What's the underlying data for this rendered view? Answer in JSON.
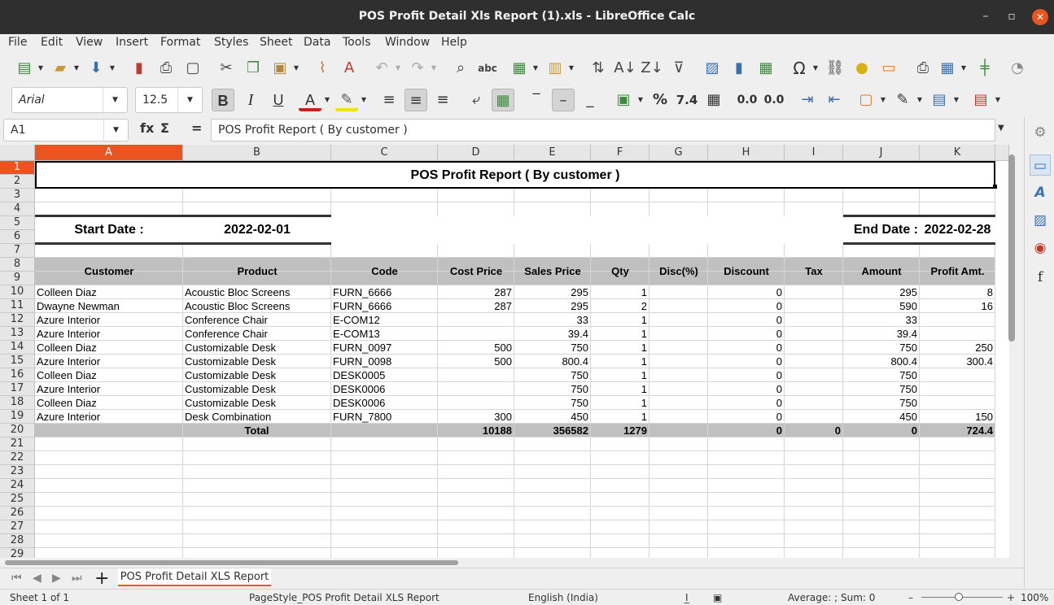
{
  "window": {
    "title": "POS Profit Detail Xls Report (1).xls - LibreOffice Calc",
    "close_glyph": "✕",
    "max_glyph": "▫",
    "min_glyph": "–"
  },
  "menu": [
    "File",
    "Edit",
    "View",
    "Insert",
    "Format",
    "Styles",
    "Sheet",
    "Data",
    "Tools",
    "Window",
    "Help"
  ],
  "font": {
    "name": "Arial",
    "size": "12.5"
  },
  "formula_bar": {
    "cell_ref": "A1",
    "content": "POS Profit Report ( By customer )",
    "fx": "fx",
    "sigma": "Σ",
    "eq": "="
  },
  "columns": [
    "A",
    "B",
    "C",
    "D",
    "E",
    "F",
    "G",
    "H",
    "I",
    "J",
    "K"
  ],
  "rows": [
    "1",
    "2",
    "3",
    "4",
    "5",
    "6",
    "7",
    "8",
    "9",
    "10",
    "11",
    "12",
    "13",
    "14",
    "15",
    "16",
    "17",
    "18",
    "19",
    "20",
    "21",
    "22",
    "23",
    "24",
    "25",
    "26",
    "27",
    "28",
    "29"
  ],
  "report": {
    "title": "POS Profit Report ( By customer )",
    "start_label": "Start Date :",
    "start_value": "2022-02-01",
    "end_label": "End Date :",
    "end_value": "2022-02-28",
    "headers": [
      "Customer",
      "Product",
      "Code",
      "Cost Price",
      "Sales Price",
      "Qty",
      "Disc(%)",
      "Discount",
      "Tax",
      "Amount",
      "Profit Amt."
    ],
    "data": [
      [
        "Colleen Diaz",
        "Acoustic Bloc Screens",
        "FURN_6666",
        "287",
        "295",
        "1",
        "",
        "0",
        "",
        "295",
        "8"
      ],
      [
        "Dwayne Newman",
        "Acoustic Bloc Screens",
        "FURN_6666",
        "287",
        "295",
        "2",
        "",
        "0",
        "",
        "590",
        "16"
      ],
      [
        "Azure Interior",
        "Conference Chair",
        "E-COM12",
        "",
        "33",
        "1",
        "",
        "0",
        "",
        "33",
        ""
      ],
      [
        "Azure Interior",
        "Conference Chair",
        "E-COM13",
        "",
        "39.4",
        "1",
        "",
        "0",
        "",
        "39.4",
        ""
      ],
      [
        "Colleen Diaz",
        "Customizable Desk",
        "FURN_0097",
        "500",
        "750",
        "1",
        "",
        "0",
        "",
        "750",
        "250"
      ],
      [
        "Azure Interior",
        "Customizable Desk",
        "FURN_0098",
        "500",
        "800.4",
        "1",
        "",
        "0",
        "",
        "800.4",
        "300.4"
      ],
      [
        "Colleen Diaz",
        "Customizable Desk",
        "DESK0005",
        "",
        "750",
        "1",
        "",
        "0",
        "",
        "750",
        ""
      ],
      [
        "Azure Interior",
        "Customizable Desk",
        "DESK0006",
        "",
        "750",
        "1",
        "",
        "0",
        "",
        "750",
        ""
      ],
      [
        "Colleen Diaz",
        "Customizable Desk",
        "DESK0006",
        "",
        "750",
        "1",
        "",
        "0",
        "",
        "750",
        ""
      ],
      [
        "Azure Interior",
        "Desk Combination",
        "FURN_7800",
        "300",
        "450",
        "1",
        "",
        "0",
        "",
        "450",
        "150"
      ]
    ],
    "total": [
      "",
      "Total",
      "",
      "10188",
      "356582",
      "1279",
      "",
      "0",
      "0",
      "0",
      "724.4"
    ]
  },
  "tabs": {
    "sheet_name": "POS Profit Detail XLS Report",
    "add": "+"
  },
  "status": {
    "sheet": "Sheet 1 of 1",
    "page_style": "PageStyle_POS Profit Detail XLS Report",
    "language": "English (India)",
    "summary": "Average: ; Sum: 0",
    "zoom": "100%"
  },
  "accent_color": "#e95420"
}
